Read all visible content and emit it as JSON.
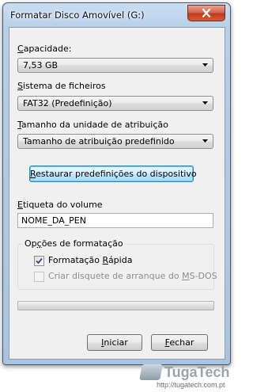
{
  "window": {
    "title": "Formatar Disco Amovível (G:)"
  },
  "capacity": {
    "label_u": "C",
    "label_rest": "apacidade:",
    "value": "7,53 GB"
  },
  "filesystem": {
    "label_u": "S",
    "label_rest": "istema de ficheiros",
    "value": "FAT32 (Predefinição)"
  },
  "allocation": {
    "label_u": "T",
    "label_rest": "amanho da unidade de atribuição",
    "value": "Tamanho de atribuição predefinido"
  },
  "restore_button": {
    "label_u": "R",
    "label_rest": "estaurar predefinições do dispositivo"
  },
  "volume_label": {
    "label_u": "E",
    "label_rest": "tiqueta do volume",
    "value": "NOME_DA_PEN"
  },
  "format_options": {
    "title_pre": "Op",
    "title_u": "ç",
    "title_rest": "ões de formatação",
    "quick_format": {
      "pre": "Formatação ",
      "u": "R",
      "rest": "ápida",
      "checked": true
    },
    "msdos": {
      "pre": "Criar disquete de arranque do ",
      "u": "M",
      "rest": "S-DOS",
      "checked": false,
      "disabled": true
    }
  },
  "progress": {
    "value": 0
  },
  "buttons": {
    "start_u": "I",
    "start_rest": "niciar",
    "close_u": "F",
    "close_rest": "echar"
  },
  "watermark": {
    "name": "TugaTech",
    "url": "http://tugatech.com.pt"
  }
}
